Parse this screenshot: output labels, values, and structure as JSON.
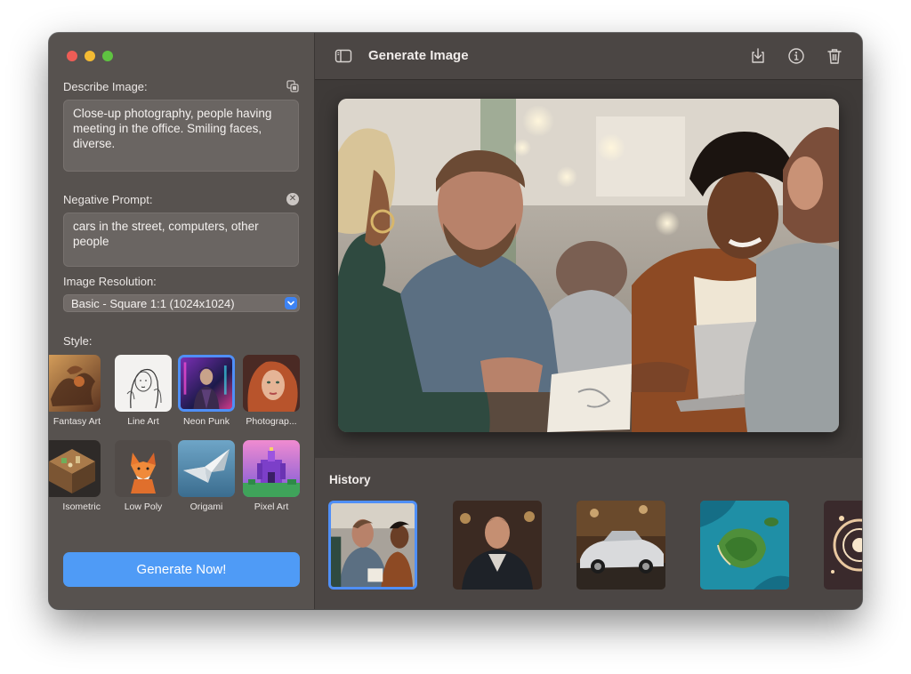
{
  "window": {
    "controls": [
      "close",
      "minimize",
      "maximize"
    ]
  },
  "sidebar": {
    "describe_label": "Describe Image:",
    "describe_value": "Close-up photography, people having meeting in the office. Smiling faces, diverse.",
    "negative_label": "Negative Prompt:",
    "negative_value": "cars in the street, computers, other people",
    "resolution_label": "Image Resolution:",
    "resolution_value": "Basic - Square 1:1 (1024x1024)",
    "style_label": "Style:",
    "styles": [
      {
        "label": "Fantasy Art",
        "selected": false
      },
      {
        "label": "Line Art",
        "selected": false
      },
      {
        "label": "Neon Punk",
        "selected": true
      },
      {
        "label": "Photograp...",
        "selected": false
      },
      {
        "label": "Isometric",
        "selected": false
      },
      {
        "label": "Low Poly",
        "selected": false
      },
      {
        "label": "Origami",
        "selected": false
      },
      {
        "label": "Pixel Art",
        "selected": false
      }
    ],
    "generate_label": "Generate Now!"
  },
  "toolbar": {
    "title": "Generate Image",
    "icons": [
      "sidebar-toggle-icon",
      "download-icon",
      "info-icon",
      "trash-icon"
    ]
  },
  "history": {
    "title": "History",
    "items": [
      {
        "subject": "office-meeting",
        "selected": true
      },
      {
        "subject": "portrait-man",
        "selected": false
      },
      {
        "subject": "classic-car",
        "selected": false
      },
      {
        "subject": "island-aerial",
        "selected": false
      },
      {
        "subject": "abstract-portal",
        "selected": false
      }
    ]
  },
  "colors": {
    "accent": "#4f8ff7",
    "button": "#4f9bf6",
    "sidebar_bg": "#57524f",
    "main_bg": "#3e3a38"
  }
}
